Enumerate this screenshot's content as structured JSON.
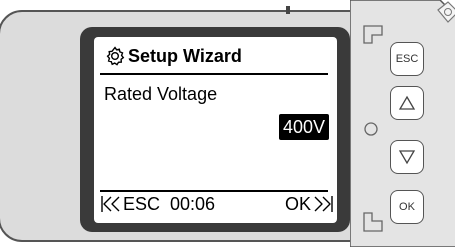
{
  "screen": {
    "title": "Setup Wizard",
    "title_icon": "gear-icon",
    "field_label": "Rated Voltage",
    "field_value": "400V",
    "footer": {
      "esc_label": "ESC",
      "timer": "00:06",
      "ok_label": "OK"
    }
  },
  "keypad": {
    "esc_label": "ESC",
    "up_icon": "triangle-up-icon",
    "down_icon": "triangle-down-icon",
    "ok_label": "OK"
  },
  "colors": {
    "casing": "#dcdcdc",
    "bezel": "#3a3a3a",
    "screen": "#ffffff",
    "highlight": "#000000"
  }
}
